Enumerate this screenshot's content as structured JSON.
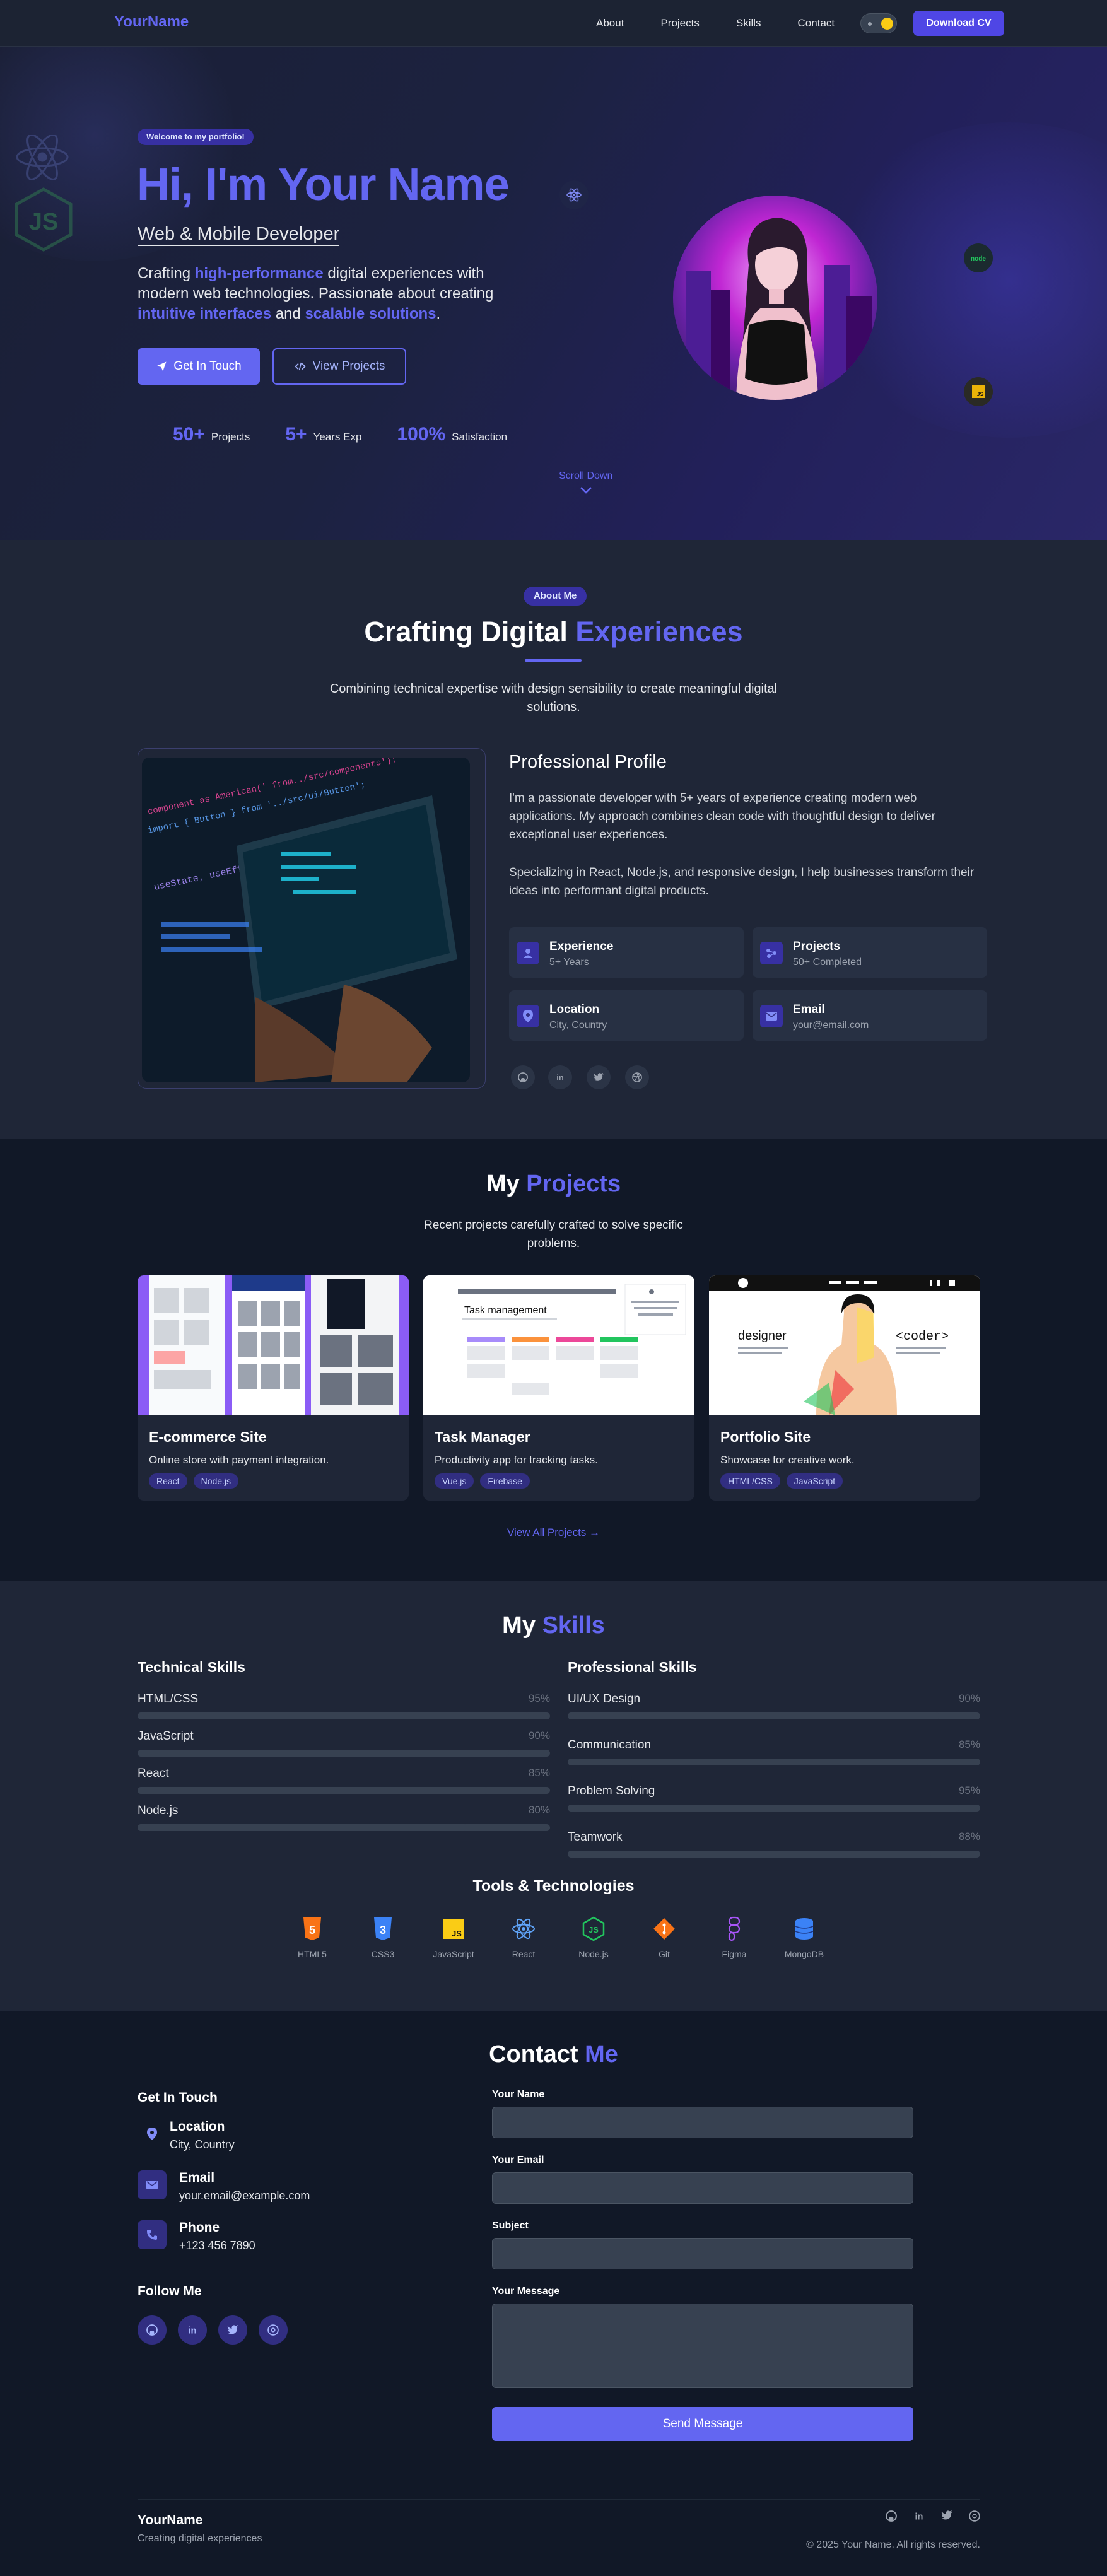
{
  "nav": {
    "logo": "YourName",
    "links": [
      "About",
      "Projects",
      "Skills",
      "Contact"
    ],
    "download_label": "Download CV"
  },
  "hero": {
    "badge": "Welcome to my portfolio!",
    "title": "Hi, I'm Your Name",
    "role": "Web & Mobile Developer",
    "desc_1": "Crafting ",
    "desc_hl_1": "high-performance",
    "desc_2": " digital experiences with modern web technologies. Passionate about creating ",
    "desc_hl_2": "intuitive interfaces",
    "desc_3": " and ",
    "desc_hl_3": "scalable solutions",
    "desc_4": ".",
    "btn_touch": "Get In Touch",
    "btn_view": "View Projects",
    "stats": [
      {
        "value": "50+",
        "label": "Projects"
      },
      {
        "value": "5+",
        "label": "Years Exp"
      },
      {
        "value": "100%",
        "label": "Satisfaction"
      }
    ],
    "scroll": "Scroll Down"
  },
  "about": {
    "pill": "About Me",
    "title_a": "Crafting Digital ",
    "title_b": "Experiences",
    "subtitle": "Combining technical expertise with design sensibility to create meaningful digital solutions.",
    "profile_title": "Professional Profile",
    "p1": "I'm a passionate developer with 5+ years of experience creating modern web applications. My approach combines clean code with thoughtful design to deliver exceptional user experiences.",
    "p2": "Specializing in React, Node.js, and responsive design, I help businesses transform their ideas into performant digital products.",
    "cards": [
      {
        "title": "Experience",
        "value": "5+ Years",
        "icon": "user-icon"
      },
      {
        "title": "Projects",
        "value": "50+ Completed",
        "icon": "share-nodes-icon"
      },
      {
        "title": "Location",
        "value": "City, Country",
        "icon": "map-pin-icon"
      },
      {
        "title": "Email",
        "value": "your@email.com",
        "icon": "envelope-icon"
      }
    ]
  },
  "projects": {
    "title_a": "My ",
    "title_b": "Projects",
    "subtitle": "Recent projects carefully crafted to solve specific problems.",
    "items": [
      {
        "title": "E-commerce Site",
        "desc": "Online store with payment integration.",
        "tags": [
          "React",
          "Node.js"
        ]
      },
      {
        "title": "Task Manager",
        "desc": "Productivity app for tracking tasks.",
        "tags": [
          "Vue.js",
          "Firebase"
        ]
      },
      {
        "title": "Portfolio Site",
        "desc": "Showcase for creative work.",
        "tags": [
          "HTML/CSS",
          "JavaScript"
        ]
      }
    ],
    "task_shot_title": "Task management",
    "portfolio_shot_left": "designer",
    "portfolio_shot_right": "<coder>",
    "view_all": "View All Projects"
  },
  "skills": {
    "title_a": "My ",
    "title_b": "Skills",
    "technical_title": "Technical Skills",
    "professional_title": "Professional Skills",
    "technical": [
      {
        "name": "HTML/CSS",
        "percent": "95%"
      },
      {
        "name": "JavaScript",
        "percent": "90%"
      },
      {
        "name": "React",
        "percent": "85%"
      },
      {
        "name": "Node.js",
        "percent": "80%"
      }
    ],
    "professional": [
      {
        "name": "UI/UX Design",
        "percent": "90%"
      },
      {
        "name": "Communication",
        "percent": "85%"
      },
      {
        "name": "Problem Solving",
        "percent": "95%"
      },
      {
        "name": "Teamwork",
        "percent": "88%"
      }
    ],
    "tools_title": "Tools & Technologies",
    "tools": [
      "HTML5",
      "CSS3",
      "JavaScript",
      "React",
      "Node.js",
      "Git",
      "Figma",
      "MongoDB"
    ]
  },
  "contact": {
    "title_a": "Contact ",
    "title_b": "Me",
    "get_in_touch": "Get In Touch",
    "items": [
      {
        "title": "Location",
        "value": "City, Country"
      },
      {
        "title": "Email",
        "value": "your.email@example.com"
      },
      {
        "title": "Phone",
        "value": "+123 456 7890"
      }
    ],
    "follow": "Follow Me",
    "form": {
      "name_label": "Your Name",
      "email_label": "Your Email",
      "subject_label": "Subject",
      "message_label": "Your Message",
      "send": "Send Message"
    }
  },
  "footer": {
    "name": "YourName",
    "tagline": "Creating digital experiences",
    "copyright": "© 2025 Your Name. All rights reserved."
  },
  "colors": {
    "accent": "#6366f1",
    "bg_dark": "#111827",
    "bg_section": "#1f2637"
  }
}
